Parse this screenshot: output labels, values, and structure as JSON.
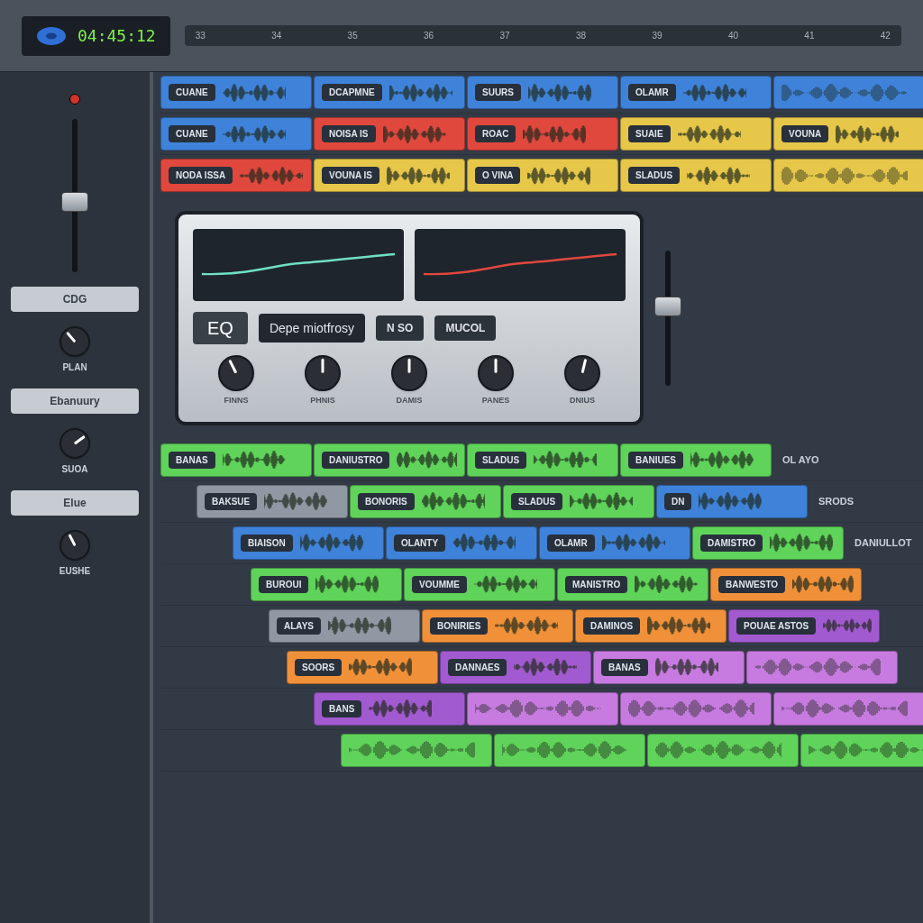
{
  "transport": {
    "display": "04:45:12",
    "ruler": [
      "33",
      "34",
      "35",
      "36",
      "37",
      "38",
      "39",
      "40",
      "41",
      "42"
    ]
  },
  "mixer": {
    "fader": {
      "level": 0.45
    },
    "buttons": [
      {
        "label": "CDG"
      },
      {
        "label": "Ebanuury"
      },
      {
        "label": "Elue"
      }
    ],
    "knobs": [
      {
        "label": "PLAN",
        "level": 0.35
      },
      {
        "label": "SUOA",
        "level": 0.7
      },
      {
        "label": "EUSHE",
        "level": 0.4
      }
    ]
  },
  "tracks_top": [
    {
      "clips": [
        {
          "label": "CUANE",
          "color": "#3f82d9"
        },
        {
          "label": "DCAPMNE",
          "color": "#3f82d9"
        },
        {
          "label": "SUURS",
          "color": "#3f82d9"
        },
        {
          "label": "OLAMR",
          "color": "#3f82d9"
        },
        {
          "color": "#3f82d9"
        }
      ]
    },
    {
      "clips": [
        {
          "label": "CUANE",
          "color": "#3f82d9"
        },
        {
          "label": "NOISA IS",
          "color": "#e0483e"
        },
        {
          "label": "ROAC",
          "color": "#e0483e"
        },
        {
          "label": "SUAIE",
          "color": "#e6c74a"
        },
        {
          "label": "VOUNA",
          "color": "#e6c74a"
        }
      ]
    },
    {
      "clips": [
        {
          "label": "NODA ISSA",
          "color": "#e0483e"
        },
        {
          "label": "VOUNA IS",
          "color": "#e6c74a"
        },
        {
          "label": "O VINA",
          "color": "#e6c74a"
        },
        {
          "label": "SLADUS",
          "color": "#e6c74a"
        },
        {
          "color": "#e6c74a"
        }
      ]
    }
  ],
  "eq_plugin": {
    "title": "EQ",
    "preset": "Depe miotfrosy",
    "buttons": [
      {
        "label": "N SO"
      },
      {
        "label": "MUCOL"
      }
    ],
    "knobs": [
      {
        "label": "FINNS",
        "level": 0.4
      },
      {
        "label": "PHNIS",
        "level": 0.5
      },
      {
        "label": "DAMIS",
        "level": 0.5
      },
      {
        "label": "PANES",
        "level": 0.5
      },
      {
        "label": "DNIUS",
        "level": 0.55
      }
    ],
    "channel_fader": {
      "level": 0.6
    }
  },
  "tracks_bottom": [
    {
      "clips": [
        {
          "label": "BANAS",
          "color": "#5fd35a"
        },
        {
          "label": "DANIUSTRO",
          "color": "#5fd35a"
        },
        {
          "label": "SLADUS",
          "color": "#5fd35a"
        },
        {
          "label": "BANIUES",
          "color": "#5fd35a"
        }
      ],
      "note": "OL AYO"
    },
    {
      "clips": [
        {
          "label": "BAKSUE",
          "color": "#8f98a3"
        },
        {
          "label": "BONORIS",
          "color": "#5fd35a"
        },
        {
          "label": "SLADUS",
          "color": "#5fd35a"
        },
        {
          "label": "DN",
          "color": "#3f82d9"
        }
      ],
      "note": "SRODS"
    },
    {
      "clips": [
        {
          "label": "BIAISON",
          "color": "#3f82d9"
        },
        {
          "label": "OLANTY",
          "color": "#3f82d9"
        },
        {
          "label": "OLAMR",
          "color": "#3f82d9"
        },
        {
          "label": "DAMISTRO",
          "color": "#5fd35a"
        }
      ],
      "note": "DANIULLOT"
    },
    {
      "clips": [
        {
          "label": "BUROUI",
          "color": "#5fd35a"
        },
        {
          "label": "VOUMME",
          "color": "#5fd35a"
        },
        {
          "label": "MANISTRO",
          "color": "#5fd35a"
        },
        {
          "label": "BANWESTO",
          "color": "#f0913a"
        }
      ]
    },
    {
      "clips": [
        {
          "label": "ALAYS",
          "color": "#8f98a3"
        },
        {
          "label": "BONIRIES",
          "color": "#f0913a"
        },
        {
          "label": "DAMINOS",
          "color": "#f0913a"
        },
        {
          "label": "POUAE ASTOS",
          "color": "#a25ad0"
        }
      ]
    },
    {
      "clips": [
        {
          "label": "SOORS",
          "color": "#f0913a"
        },
        {
          "label": "DANNAES",
          "color": "#a25ad0"
        },
        {
          "label": "BANAS",
          "color": "#c77be0"
        },
        {
          "color": "#c77be0"
        }
      ]
    },
    {
      "clips": [
        {
          "label": "BANS",
          "color": "#a25ad0"
        },
        {
          "color": "#c77be0"
        },
        {
          "color": "#c77be0"
        },
        {
          "color": "#c77be0"
        }
      ]
    },
    {
      "clips": [
        {
          "color": "#5fd35a"
        },
        {
          "color": "#5fd35a"
        },
        {
          "color": "#5fd35a"
        },
        {
          "color": "#5fd35a"
        }
      ]
    }
  ]
}
